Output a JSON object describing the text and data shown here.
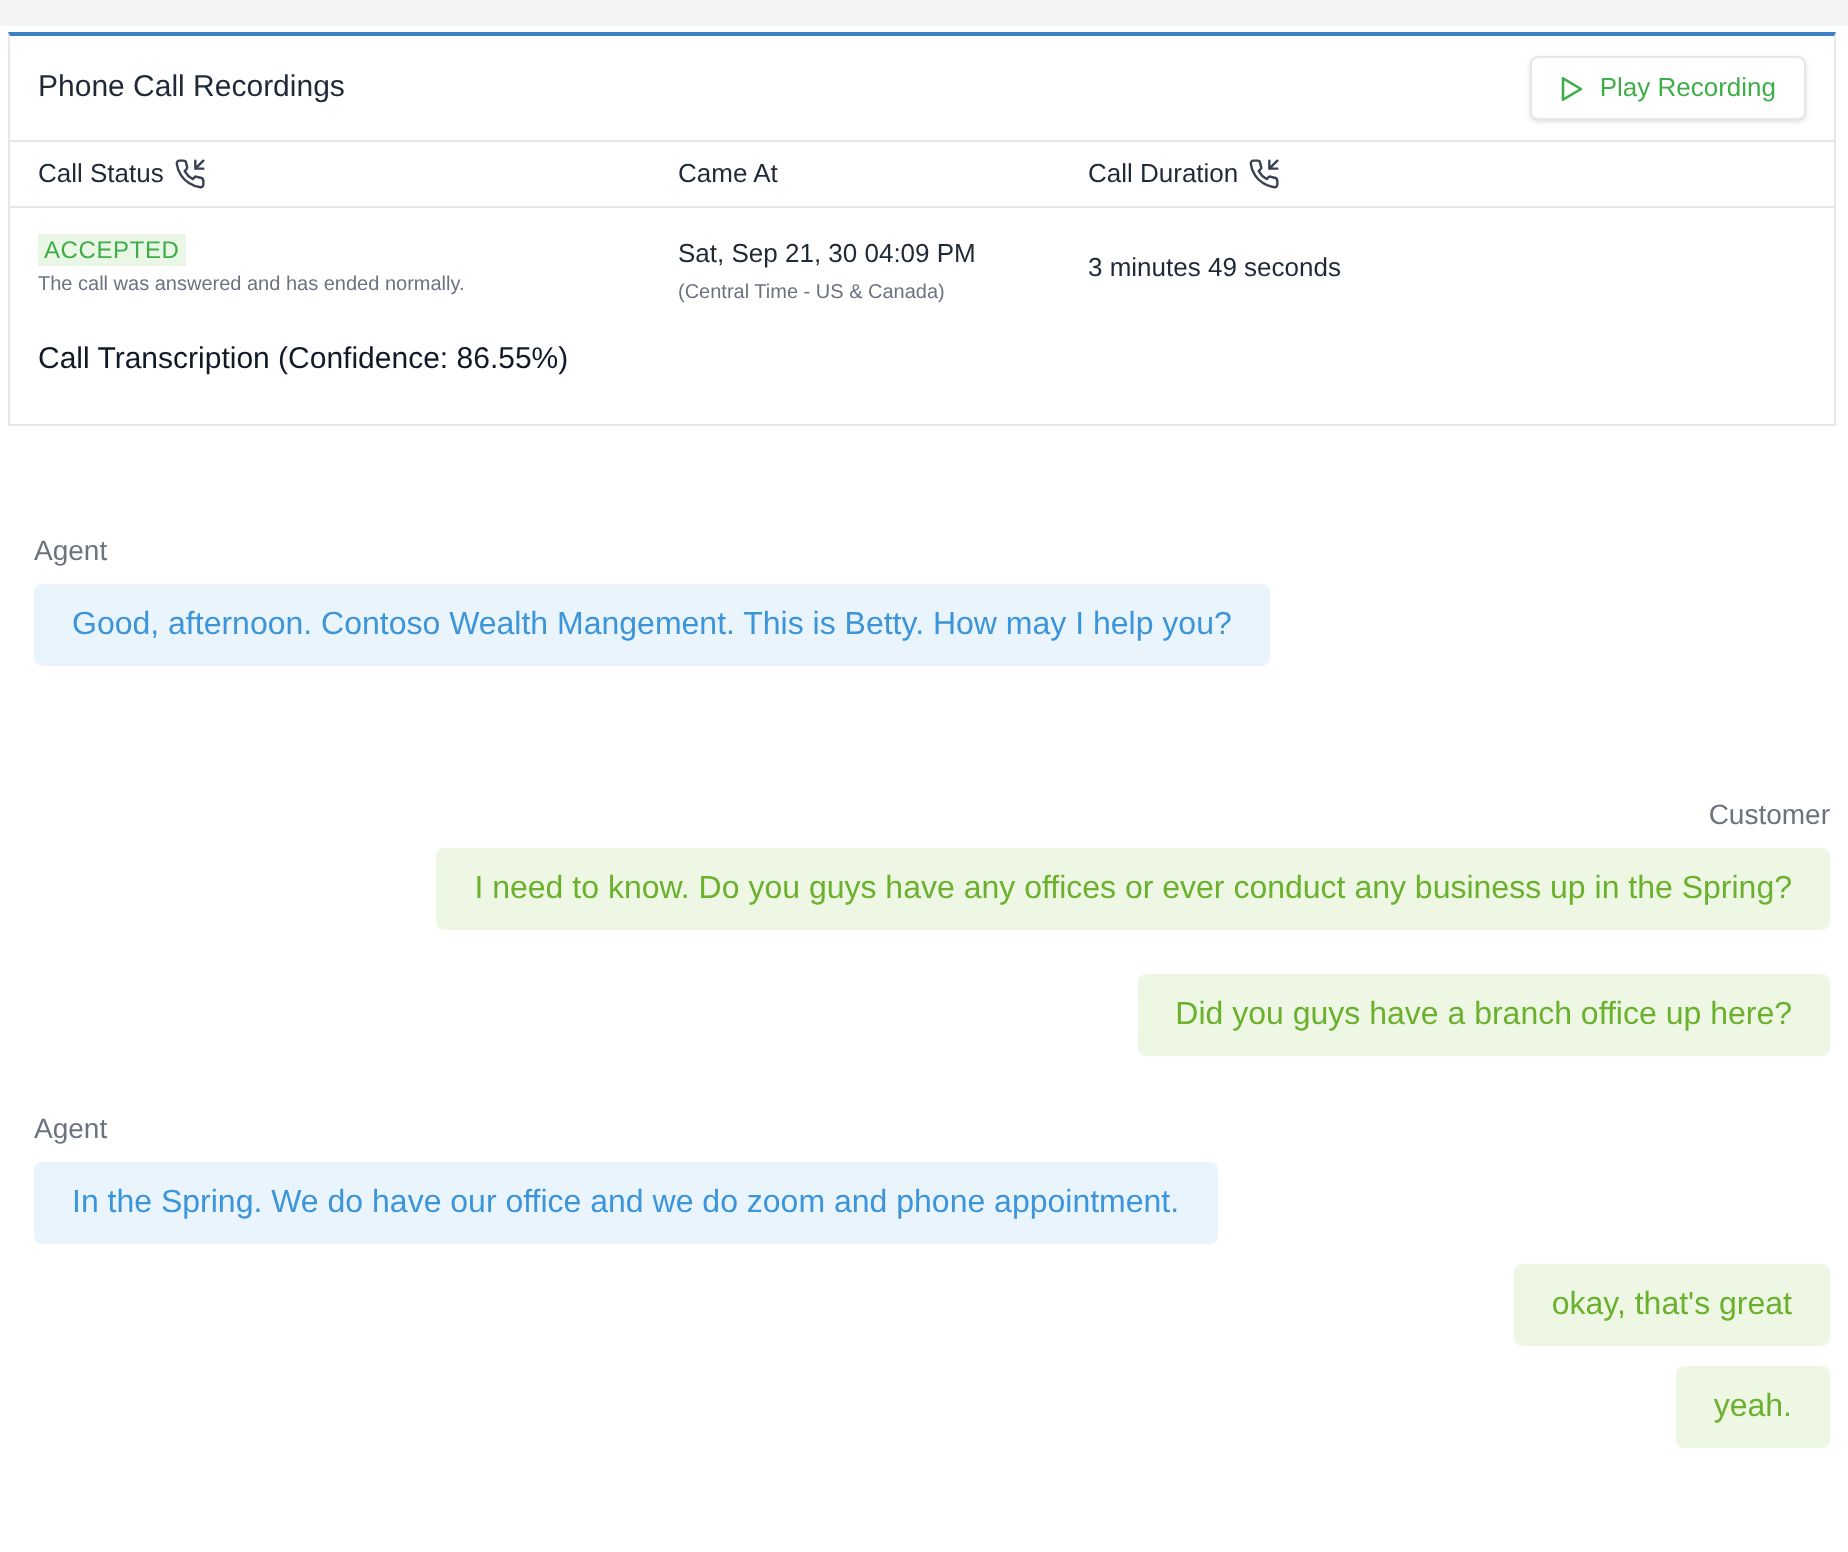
{
  "card": {
    "title": "Phone Call Recordings",
    "play_button": "Play Recording",
    "columns": [
      {
        "label": "Call Status",
        "icon": true
      },
      {
        "label": "Came At",
        "icon": false
      },
      {
        "label": "Call Duration",
        "icon": true
      }
    ],
    "status": {
      "badge": "ACCEPTED",
      "description": "The call was answered and has ended normally."
    },
    "came_at": {
      "date": "Sat, Sep 21, 30 04:09 PM",
      "timezone": "(Central Time - US & Canada)"
    },
    "duration": "3 minutes 49 seconds",
    "transcription_title": "Call Transcription (Confidence: 86.55%)"
  },
  "messages": [
    {
      "kind": "agent",
      "label": "Agent",
      "text": "Good, afternoon. Contoso Wealth Mangement. This is Betty. How may I help you?"
    },
    {
      "kind": "customer",
      "label": "Customer",
      "text": "I need to know. Do you guys have any offices or ever conduct any business up in the Spring?"
    },
    {
      "kind": "customer",
      "text": "Did you guys have a branch office up here?"
    },
    {
      "kind": "agent",
      "label": "Agent",
      "text": "In the Spring. We do have our office and we do zoom and phone appointment."
    },
    {
      "kind": "customer",
      "text": "okay, that's great"
    },
    {
      "kind": "customer",
      "text": "yeah."
    }
  ]
}
